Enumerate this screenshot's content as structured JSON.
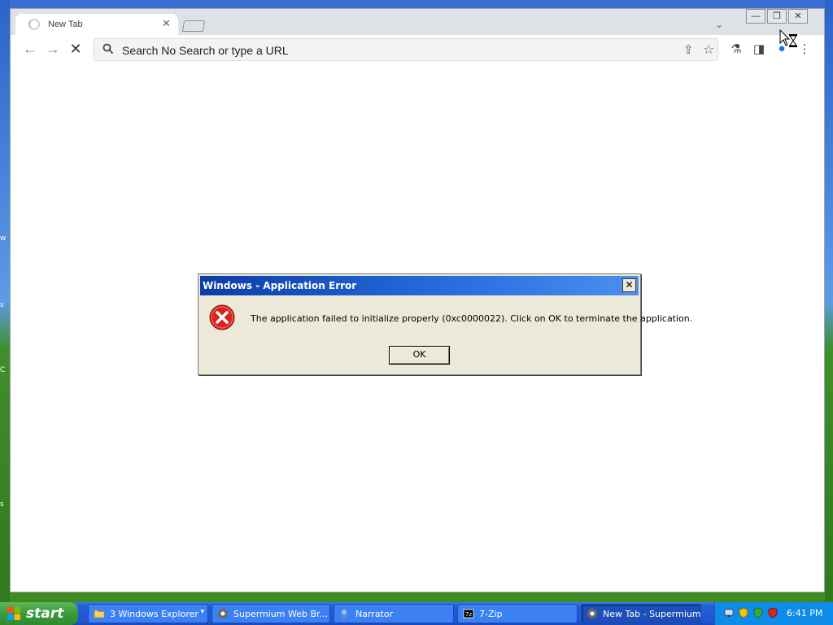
{
  "desktop": {
    "edge_labels": [
      "w",
      "s",
      "C",
      "s"
    ]
  },
  "browser": {
    "tab": {
      "title": "New Tab",
      "close_glyph": "✕"
    },
    "window_controls": {
      "minimize": "—",
      "restore": "❐",
      "close": "✕"
    },
    "omnibox": {
      "placeholder": "Search No Search or type a URL"
    }
  },
  "dialog": {
    "title": "Windows - Application Error",
    "close_glyph": "✕",
    "message": "The application failed to initialize properly (0xc0000022). Click on OK to terminate the application.",
    "ok_label": "OK"
  },
  "taskbar": {
    "start_label": "start",
    "tasks": [
      {
        "label": "3 Windows Explorer",
        "icon": "folder-icon"
      },
      {
        "label": "Supermium Web Br...",
        "icon": "supermium-icon"
      },
      {
        "label": "Narrator",
        "icon": "narrator-icon"
      },
      {
        "label": "7-Zip",
        "icon": "sevenzip-icon"
      },
      {
        "label": "New Tab - Supermium",
        "icon": "supermium-icon"
      }
    ],
    "clock": "6:41 PM"
  },
  "colors": {
    "titlebar": "#0a3da8",
    "error_red": "#d8231e",
    "taskbar_blue": "#245edb",
    "start_green": "#3a9a3a"
  }
}
